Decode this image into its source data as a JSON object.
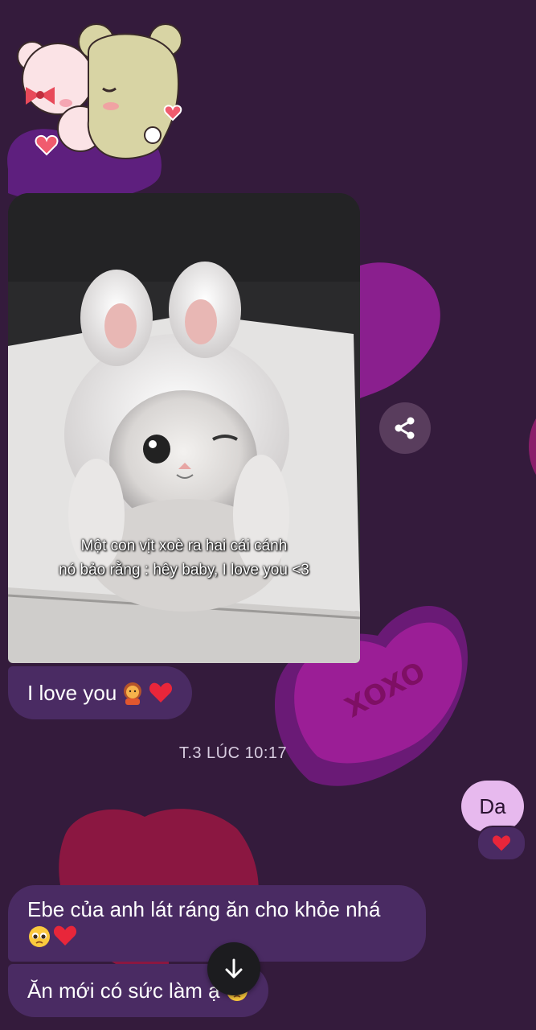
{
  "colors": {
    "background": "#341b3c",
    "incoming_bubble": "#4a2b63",
    "outgoing_bubble": "#e7b9ee"
  },
  "sticker": {
    "icon": "bear-couple-sticker"
  },
  "media": {
    "caption_line1": "Một con vịt xoè ra hai cái cánh",
    "caption_line2": "nó bảo rằng : hêy baby, I love you <3",
    "watermark": "@",
    "watermark_icon": "tiktok-icon"
  },
  "messages": [
    {
      "direction": "incoming",
      "text": "I love you",
      "emojis": [
        "person-gesturing-icon",
        "red-heart-icon"
      ]
    },
    {
      "direction": "outgoing",
      "text": "Da",
      "reaction": "red-heart-icon"
    },
    {
      "direction": "incoming",
      "text": "Ebe của anh lát ráng ăn cho khỏe nhá",
      "emojis": [
        "pleading-face-icon",
        "red-heart-icon"
      ]
    },
    {
      "direction": "incoming",
      "text": "Ăn mới có sức làm ạ",
      "emojis": [
        "pleading-face-icon"
      ]
    }
  ],
  "timestamp": "T.3 LÚC 10:17",
  "buttons": {
    "share_icon": "share-icon",
    "scroll_icon": "arrow-down-icon"
  }
}
